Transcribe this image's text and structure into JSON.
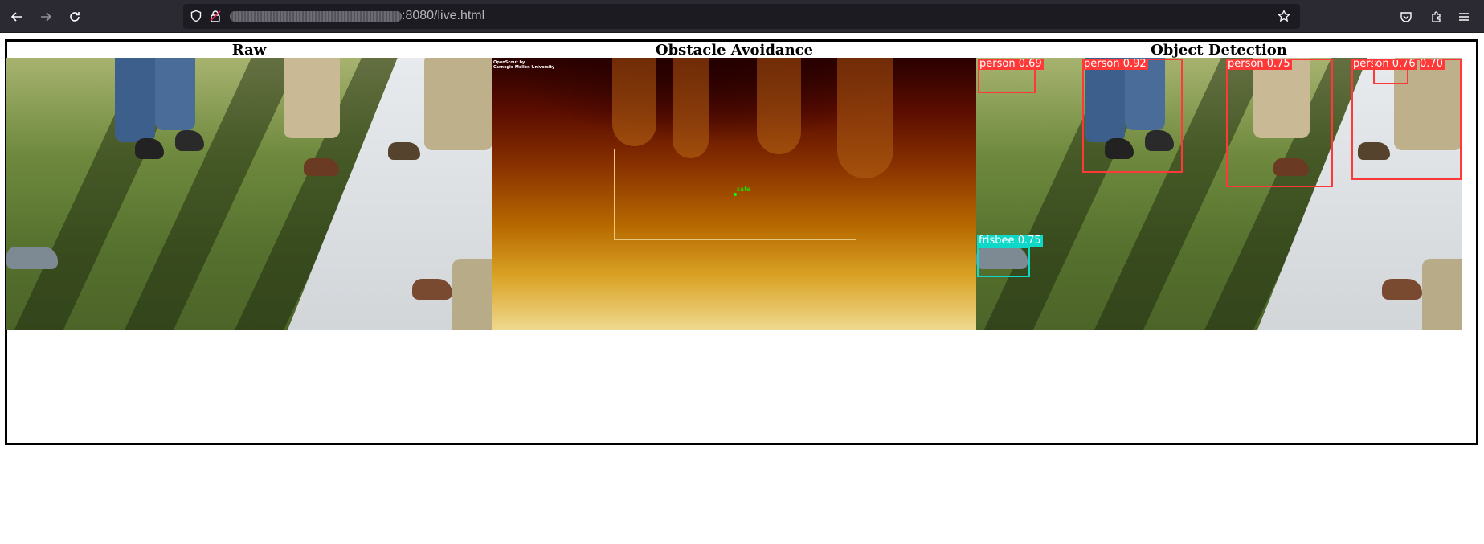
{
  "browser": {
    "url_suffix": ":8080/live.html",
    "icons": [
      "back-icon",
      "forward-icon",
      "reload-icon",
      "shield-icon",
      "lock-icon",
      "star-icon",
      "pocket-icon",
      "extensions-icon",
      "menu-icon"
    ]
  },
  "panels": {
    "raw": {
      "title": "Raw"
    },
    "obstacle": {
      "title": "Obstacle Avoidance",
      "credit": "OpenScout by\nCarnegie Mellon University",
      "status_label": "safe"
    },
    "detection": {
      "title": "Object Detection",
      "detections": [
        {
          "label": "person",
          "score": "0.69"
        },
        {
          "label": "person",
          "score": "0.92"
        },
        {
          "label": "person",
          "score": "0.75"
        },
        {
          "label": "person",
          "score": "0.76"
        },
        {
          "label": "person",
          "score": "0.70"
        },
        {
          "label": "frisbee",
          "score": "0.75"
        }
      ],
      "colors": {
        "person": "#ff3838",
        "frisbee": "#10d8c8"
      }
    }
  }
}
